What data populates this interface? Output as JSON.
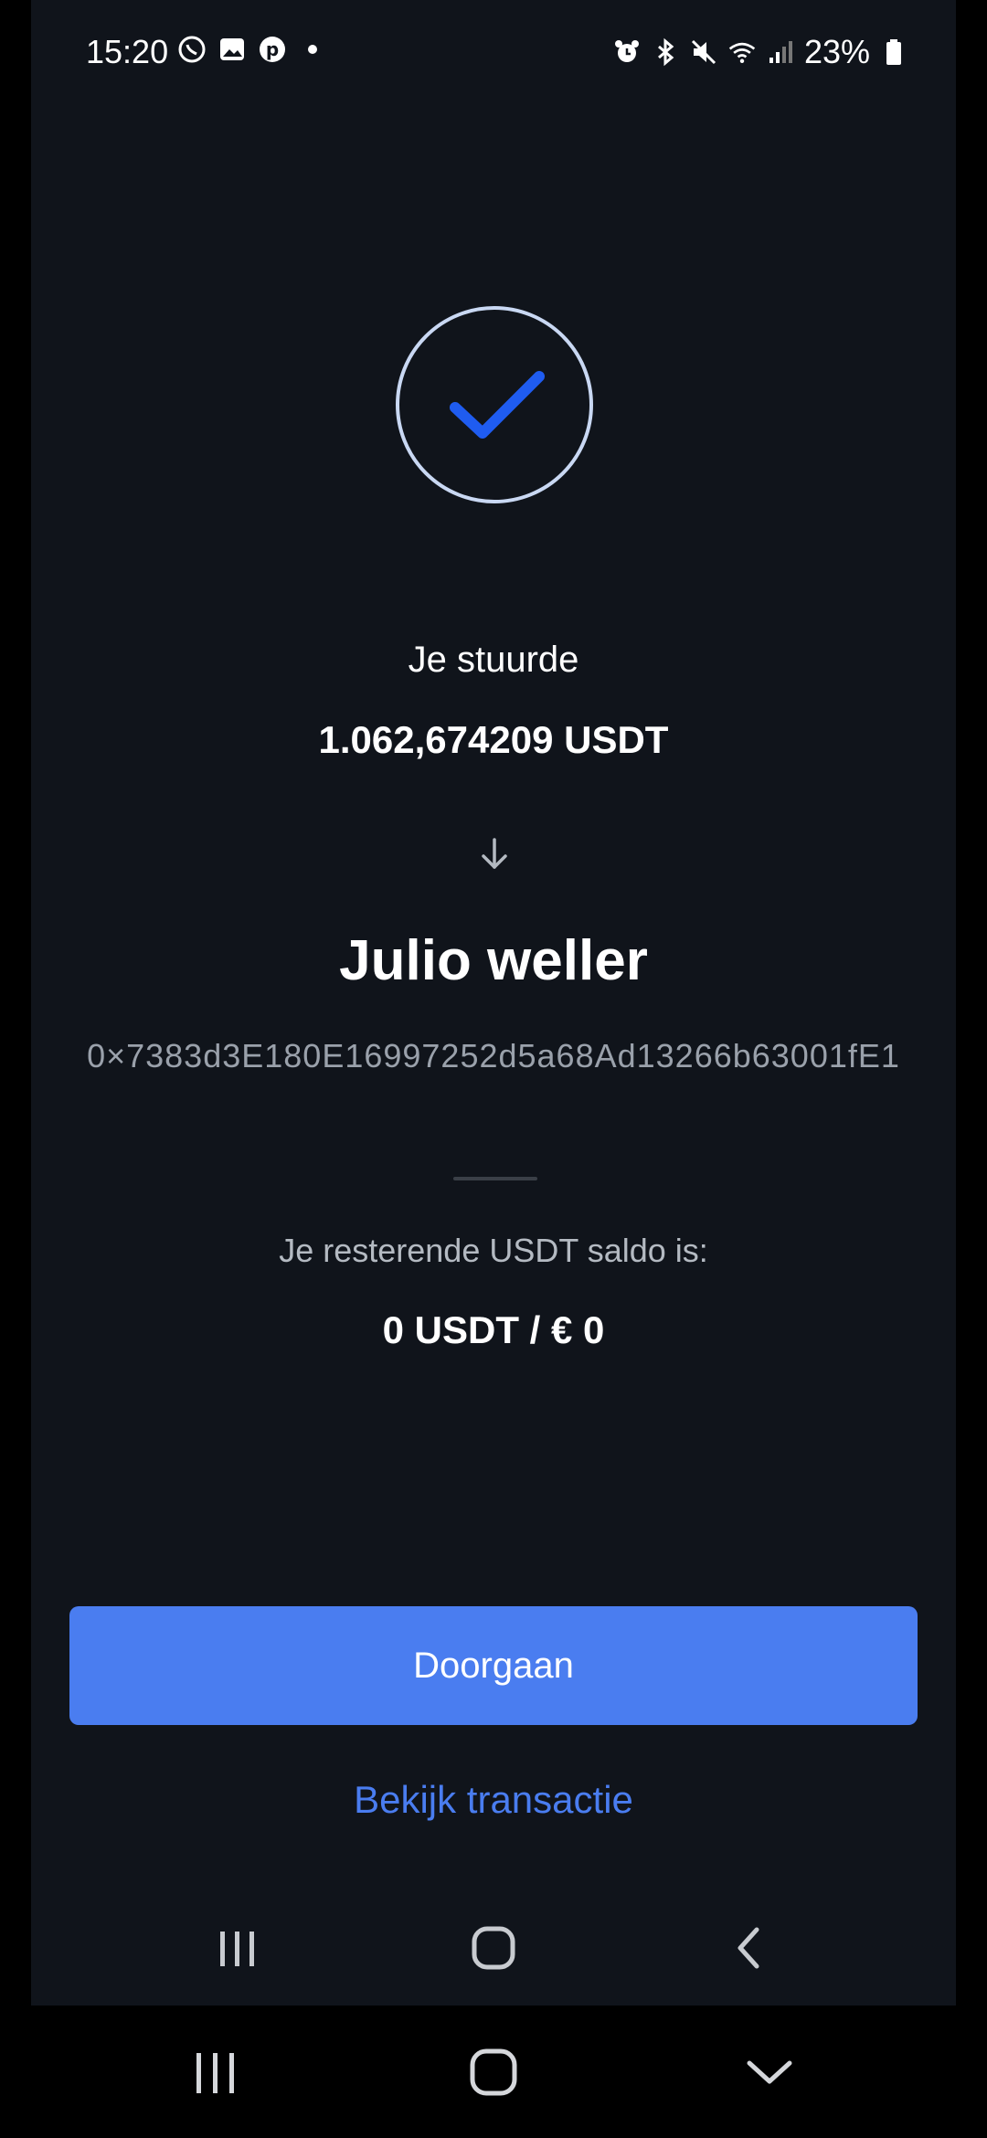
{
  "status_bar": {
    "time": "15:20",
    "battery": "23%",
    "left_icons": [
      "whatsapp-icon",
      "gallery-icon",
      "pinterest-icon",
      "dot-icon"
    ],
    "right_icons": [
      "alarm-icon",
      "bluetooth-icon",
      "mute-icon",
      "wifi-icon",
      "signal-icon",
      "battery-icon"
    ]
  },
  "result": {
    "sent_label": "Je stuurde",
    "amount": "1.062,674209 USDT",
    "recipient_name": "Julio weller",
    "address": "0×7383d3E180E16997252d5a68Ad13266b63001fE1",
    "balance_label": "Je resterende USDT saldo is:",
    "balance_value": "0 USDT / € 0"
  },
  "actions": {
    "continue_label": "Doorgaan",
    "view_transaction_label": "Bekijk transactie"
  },
  "colors": {
    "background": "#10141b",
    "accent": "#4a7df0",
    "check": "#1f5cf0"
  }
}
